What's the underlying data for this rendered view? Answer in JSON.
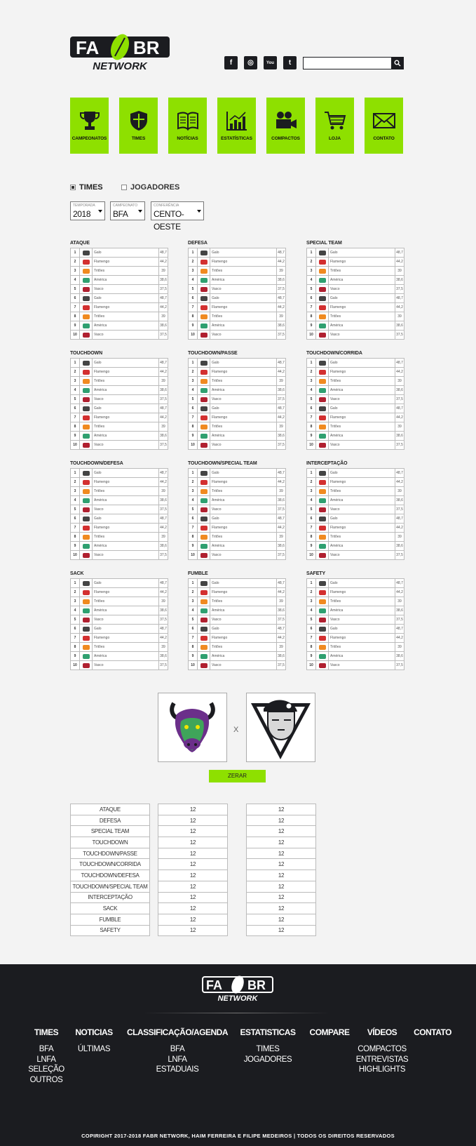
{
  "brand": {
    "logo_top": "FA BR",
    "logo_bottom": "NETWORK"
  },
  "social": [
    {
      "name": "facebook-icon",
      "glyph": "f"
    },
    {
      "name": "instagram-icon",
      "glyph": "◎"
    },
    {
      "name": "youtube-icon",
      "glyph": "You"
    },
    {
      "name": "twitter-icon",
      "glyph": "t"
    }
  ],
  "search": {
    "placeholder": ""
  },
  "nav": [
    "CAMPEONATOS",
    "TIMES",
    "NOTÍCIAS",
    "ESTATÍSTICAS",
    "COMPACTOS",
    "LOJA",
    "CONTATO"
  ],
  "toggle": {
    "times": "TIMES",
    "jogadores": "JOGADORES"
  },
  "filters": {
    "temporada": {
      "label": "TEMPORADA",
      "value": "2018"
    },
    "campeonato": {
      "label": "CAMPEONATO",
      "value": "BFA"
    },
    "conferencia": {
      "label": "CONFERÊNCIA",
      "value": "CENTO-OESTE"
    }
  },
  "team_colors": {
    "Galo": "#444444",
    "Flamengo": "#d33030",
    "Tritões": "#f08a20",
    "América": "#2fa070",
    "Vasco": "#b02030"
  },
  "ranking_rows": [
    {
      "rank": "1",
      "team": "Galo",
      "value": "48,7"
    },
    {
      "rank": "2",
      "team": "Flamengo",
      "value": "44,2"
    },
    {
      "rank": "3",
      "team": "Tritões",
      "value": "39"
    },
    {
      "rank": "4",
      "team": "América",
      "value": "38,6"
    },
    {
      "rank": "5",
      "team": "Vasco",
      "value": "37,5"
    },
    {
      "rank": "6",
      "team": "Galo",
      "value": "48,7"
    },
    {
      "rank": "7",
      "team": "Flamengo",
      "value": "44,2"
    },
    {
      "rank": "8",
      "team": "Tritões",
      "value": "39"
    },
    {
      "rank": "9",
      "team": "América",
      "value": "38,6"
    },
    {
      "rank": "10",
      "team": "Vasco",
      "value": "37,5"
    }
  ],
  "categories": [
    "ATAQUE",
    "DEFESA",
    "SPECIAL TEAM",
    "TOUCHDOWN",
    "TOUCHDOWN/PASSE",
    "TOUCHDOWN/CORRIDA",
    "TOUCHDOWN/DEFESA",
    "TOUCHDOWN/SPECIAL TEAM",
    "INTERCEPTAÇÃO",
    "SACK",
    "FUMBLE",
    "SAFETY"
  ],
  "compare": {
    "vs": "X",
    "reset": "ZERAR",
    "left_values": [
      "12",
      "12",
      "12",
      "12",
      "12",
      "12",
      "12",
      "12",
      "12",
      "12",
      "12",
      "12"
    ],
    "right_values": [
      "12",
      "12",
      "12",
      "12",
      "12",
      "12",
      "12",
      "12",
      "12",
      "12",
      "12",
      "12"
    ]
  },
  "footer": {
    "columns": [
      {
        "title": "TIMES",
        "items": [
          "BFA",
          "LNFA",
          "SELEÇÃO",
          "OUTROS"
        ]
      },
      {
        "title": "NOTICIAS",
        "items": [
          "ÚLTIMAS"
        ]
      },
      {
        "title": "CLASSIFICAÇÃO/AGENDA",
        "items": [
          "BFA",
          "LNFA",
          "ESTADUAIS"
        ]
      },
      {
        "title": "ESTATISTICAS",
        "items": [
          "TIMES",
          "JOGADORES"
        ]
      },
      {
        "title": "COMPARE",
        "items": []
      },
      {
        "title": "VÍDEOS",
        "items": [
          "COMPACTOS",
          "ENTREVISTAS",
          "HIGHLIGHTS"
        ]
      },
      {
        "title": "CONTATO",
        "items": []
      }
    ],
    "copyright": "COPIRIGHT 2017-2018 FABR NETWORK, HAIM FERREIRA E FILIPE MEDEIROS  |  TODOS OS DIREITOS RESERVADOS"
  }
}
